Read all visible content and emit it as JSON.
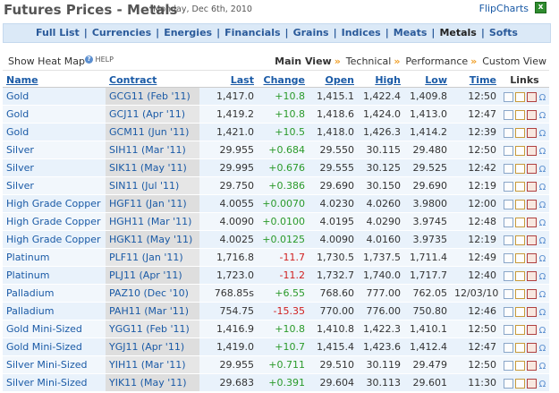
{
  "header": {
    "title": "Futures Prices - Metals",
    "date": "Monday, Dec 6th, 2010",
    "flipcharts": "FlipCharts",
    "excel_icon": "excel-icon",
    "excel_glyph": "x"
  },
  "nav": {
    "items": [
      "Full List",
      "Currencies",
      "Energies",
      "Financials",
      "Grains",
      "Indices",
      "Meats",
      "Metals",
      "Softs"
    ],
    "active": "Metals",
    "separator": "|"
  },
  "toolbar": {
    "heat_map": "Show Heat Map",
    "help": "HELP",
    "help_glyph": "?",
    "views": [
      "Main View",
      "Technical",
      "Performance",
      "Custom View"
    ],
    "active_view": "Main View",
    "arrow": "»"
  },
  "table": {
    "headers": {
      "name": "Name",
      "contract": "Contract",
      "last": "Last",
      "change": "Change",
      "open": "Open",
      "high": "High",
      "low": "Low",
      "time": "Time",
      "links": "Links"
    },
    "rows": [
      {
        "name": "Gold",
        "contract": "GCG11 (Feb '11)",
        "last": "1,417.0",
        "change": "+10.8",
        "open": "1,415.1",
        "high": "1,422.4",
        "low": "1,409.8",
        "time": "12:50"
      },
      {
        "name": "Gold",
        "contract": "GCJ11 (Apr '11)",
        "last": "1,419.2",
        "change": "+10.8",
        "open": "1,418.6",
        "high": "1,424.0",
        "low": "1,413.0",
        "time": "12:47"
      },
      {
        "name": "Gold",
        "contract": "GCM11 (Jun '11)",
        "last": "1,421.0",
        "change": "+10.5",
        "open": "1,418.0",
        "high": "1,426.3",
        "low": "1,414.2",
        "time": "12:39"
      },
      {
        "name": "Silver",
        "contract": "SIH11 (Mar '11)",
        "last": "29.955",
        "change": "+0.684",
        "open": "29.550",
        "high": "30.115",
        "low": "29.480",
        "time": "12:50"
      },
      {
        "name": "Silver",
        "contract": "SIK11 (May '11)",
        "last": "29.995",
        "change": "+0.676",
        "open": "29.555",
        "high": "30.125",
        "low": "29.525",
        "time": "12:42"
      },
      {
        "name": "Silver",
        "contract": "SIN11 (Jul '11)",
        "last": "29.750",
        "change": "+0.386",
        "open": "29.690",
        "high": "30.150",
        "low": "29.690",
        "time": "12:19"
      },
      {
        "name": "High Grade Copper",
        "contract": "HGF11 (Jan '11)",
        "last": "4.0055",
        "change": "+0.0070",
        "open": "4.0230",
        "high": "4.0260",
        "low": "3.9800",
        "time": "12:00"
      },
      {
        "name": "High Grade Copper",
        "contract": "HGH11 (Mar '11)",
        "last": "4.0090",
        "change": "+0.0100",
        "open": "4.0195",
        "high": "4.0290",
        "low": "3.9745",
        "time": "12:48"
      },
      {
        "name": "High Grade Copper",
        "contract": "HGK11 (May '11)",
        "last": "4.0025",
        "change": "+0.0125",
        "open": "4.0090",
        "high": "4.0160",
        "low": "3.9735",
        "time": "12:19"
      },
      {
        "name": "Platinum",
        "contract": "PLF11 (Jan '11)",
        "last": "1,716.8",
        "change": "-11.7",
        "open": "1,730.5",
        "high": "1,737.5",
        "low": "1,711.4",
        "time": "12:49"
      },
      {
        "name": "Platinum",
        "contract": "PLJ11 (Apr '11)",
        "last": "1,723.0",
        "change": "-11.2",
        "open": "1,732.7",
        "high": "1,740.0",
        "low": "1,717.7",
        "time": "12:40"
      },
      {
        "name": "Palladium",
        "contract": "PAZ10 (Dec '10)",
        "last": "768.85s",
        "change": "+6.55",
        "open": "768.60",
        "high": "777.00",
        "low": "762.05",
        "time": "12/03/10"
      },
      {
        "name": "Palladium",
        "contract": "PAH11 (Mar '11)",
        "last": "754.75",
        "change": "-15.35",
        "open": "770.00",
        "high": "776.00",
        "low": "750.80",
        "time": "12:46"
      },
      {
        "name": "Gold Mini-Sized",
        "contract": "YGG11 (Feb '11)",
        "last": "1,416.9",
        "change": "+10.8",
        "open": "1,410.8",
        "high": "1,422.3",
        "low": "1,410.1",
        "time": "12:50"
      },
      {
        "name": "Gold Mini-Sized",
        "contract": "YGJ11 (Apr '11)",
        "last": "1,419.0",
        "change": "+10.7",
        "open": "1,415.4",
        "high": "1,423.6",
        "low": "1,412.4",
        "time": "12:47"
      },
      {
        "name": "Silver Mini-Sized",
        "contract": "YIH11 (Mar '11)",
        "last": "29.955",
        "change": "+0.711",
        "open": "29.510",
        "high": "30.119",
        "low": "29.479",
        "time": "12:50"
      },
      {
        "name": "Silver Mini-Sized",
        "contract": "YIK11 (May '11)",
        "last": "29.683",
        "change": "+0.391",
        "open": "29.604",
        "high": "30.113",
        "low": "29.601",
        "time": "11:30"
      }
    ],
    "link_icons": [
      "chart-icon",
      "line-chart-icon",
      "options-icon",
      "omega-icon"
    ],
    "omega_glyph": "Ω"
  },
  "colors": {
    "positive": "#2a9a2a",
    "negative": "#d02020",
    "link": "#1a5aa6",
    "nav_bg": "#dbe9f7",
    "accent": "#f0a02a"
  }
}
